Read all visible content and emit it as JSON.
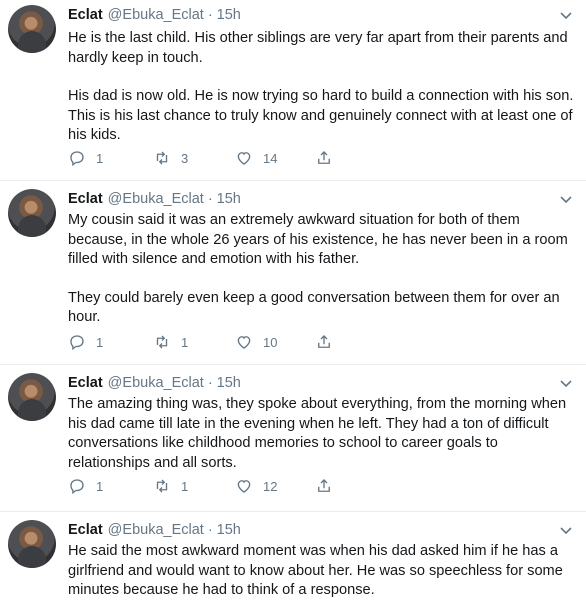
{
  "tweets": [
    {
      "name": "Eclat",
      "handle": "@Ebuka_Eclat",
      "time": "15h",
      "paragraphs": [
        "He is the last child. His other siblings are very far apart from their parents and hardly keep in touch.",
        "His dad is now old. He is now trying so hard to build a connection with his son. This is his last chance to truly know and genuinely connect with at least one of his kids."
      ],
      "replies": "1",
      "retweets": "3",
      "likes": "14"
    },
    {
      "name": "Eclat",
      "handle": "@Ebuka_Eclat",
      "time": "15h",
      "paragraphs": [
        "My cousin said it was an extremely awkward situation for both of them because, in the whole 26 years of his existence, he has never been in a room filled with silence and emotion with his father.",
        "They could barely even keep a good conversation between them for over an hour."
      ],
      "replies": "1",
      "retweets": "1",
      "likes": "10"
    },
    {
      "name": "Eclat",
      "handle": "@Ebuka_Eclat",
      "time": "15h",
      "paragraphs": [
        "The amazing thing was, they spoke about everything, from the morning when his dad came till late in the evening when he left. They had a ton of difficult conversations like childhood memories to school to career goals to relationships and all sorts."
      ],
      "replies": "1",
      "retweets": "1",
      "likes": "12"
    },
    {
      "name": "Eclat",
      "handle": "@Ebuka_Eclat",
      "time": "15h",
      "paragraphs": [
        "He said the most awkward moment was when his dad asked him if he has a girlfriend and would want to know about her. He was so speechless for some minutes because he had to think of a response."
      ]
    }
  ],
  "icons": {
    "reply": "reply-icon",
    "retweet": "retweet-icon",
    "like": "heart-icon",
    "share": "share-icon",
    "menu": "chevron-down-icon"
  },
  "colors": {
    "text": "#14171a",
    "secondary": "#657786",
    "divider": "#e6ecf0"
  }
}
